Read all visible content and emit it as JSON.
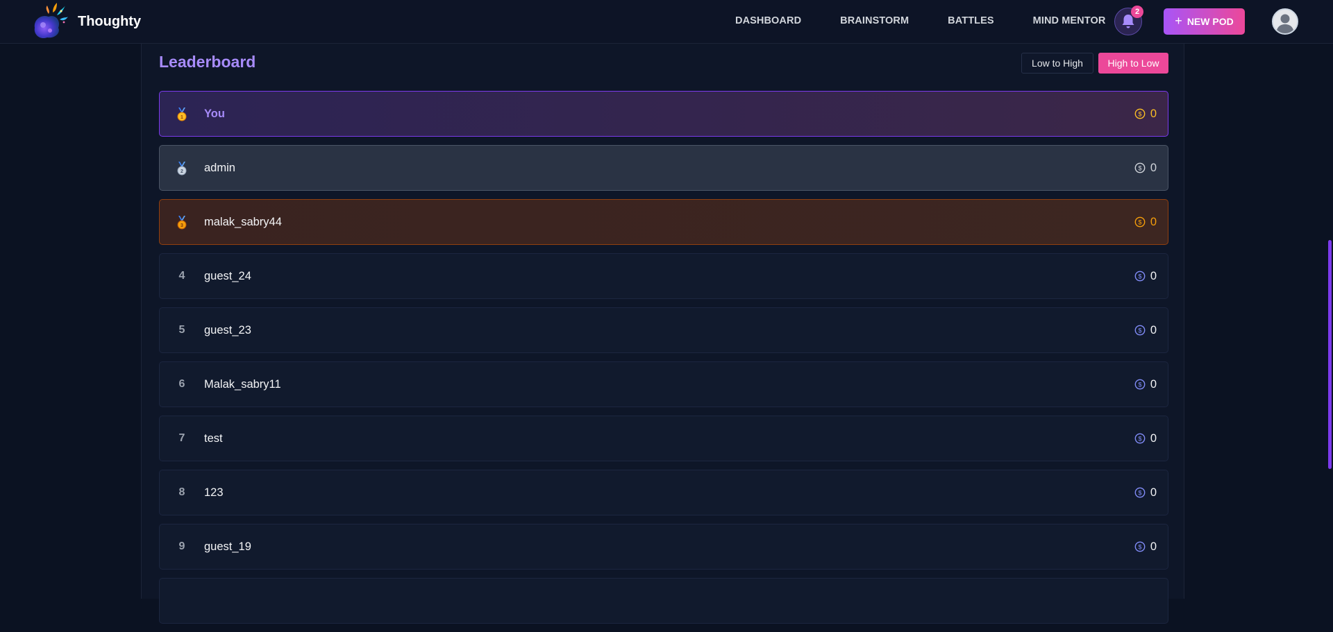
{
  "header": {
    "brand": "Thoughty",
    "nav": [
      "DASHBOARD",
      "BRAINSTORM",
      "BATTLES",
      "MIND MENTOR"
    ],
    "notifications_count": "2",
    "new_pod_label": "NEW POD"
  },
  "leaderboard": {
    "title": "Leaderboard",
    "sort_low": "Low to High",
    "sort_high": "High to Low",
    "active_sort": "High to Low",
    "rows": [
      {
        "rank": "1",
        "medal": "gold",
        "name": "You",
        "score": "0"
      },
      {
        "rank": "2",
        "medal": "silver",
        "name": "admin",
        "score": "0"
      },
      {
        "rank": "3",
        "medal": "bronze",
        "name": "malak_sabry44",
        "score": "0"
      },
      {
        "rank": "4",
        "medal": "",
        "name": "guest_24",
        "score": "0"
      },
      {
        "rank": "5",
        "medal": "",
        "name": "guest_23",
        "score": "0"
      },
      {
        "rank": "6",
        "medal": "",
        "name": "Malak_sabry11",
        "score": "0"
      },
      {
        "rank": "7",
        "medal": "",
        "name": "test",
        "score": "0"
      },
      {
        "rank": "8",
        "medal": "",
        "name": "123",
        "score": "0"
      },
      {
        "rank": "9",
        "medal": "",
        "name": "guest_19",
        "score": "0"
      }
    ]
  },
  "colors": {
    "accent_purple": "#a855f7",
    "accent_pink": "#ec4899",
    "coin_default": "#818cf8",
    "gold": "#fbbf24",
    "bronze": "#f59e0b"
  },
  "icons": [
    "logo-icon",
    "bell-icon",
    "plus-icon",
    "avatar-icon",
    "medal-icon",
    "coin-icon"
  ]
}
